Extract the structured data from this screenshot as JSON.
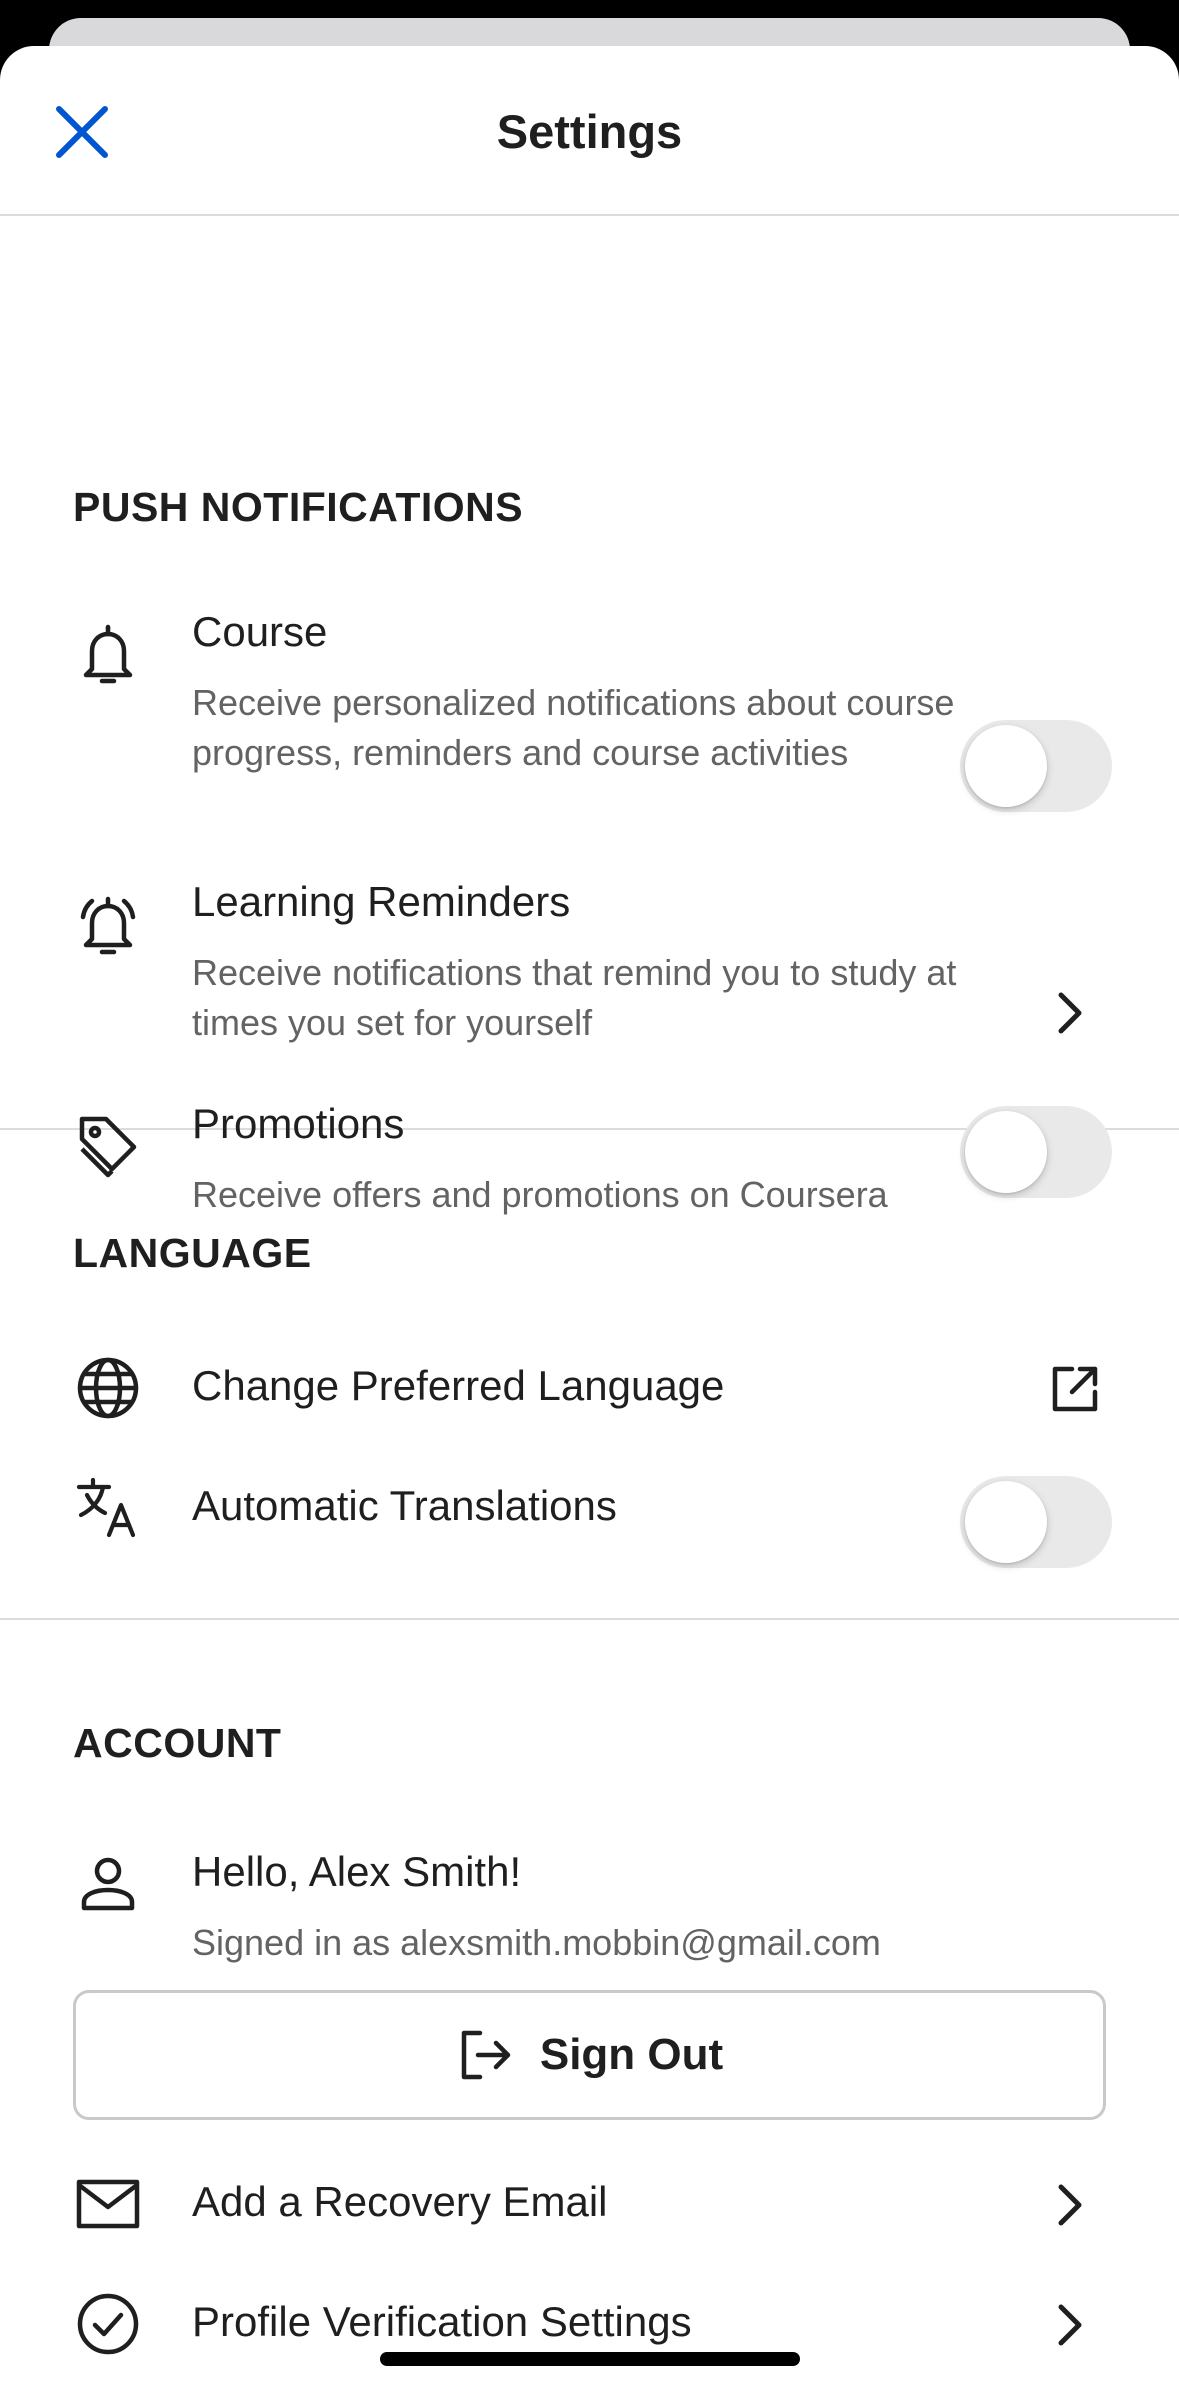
{
  "header": {
    "title": "Settings"
  },
  "push_notifications": {
    "title": "PUSH NOTIFICATIONS",
    "items": [
      {
        "label": "Course",
        "description": "Receive personalized notifications about course progress, reminders and course activities",
        "icon": "bell-icon",
        "control": "toggle",
        "enabled": false
      },
      {
        "label": "Learning Reminders",
        "description": "Receive notifications that remind you to study at times you set for yourself",
        "icon": "alarm-bell-icon",
        "control": "chevron"
      },
      {
        "label": "Promotions",
        "description": "Receive offers and promotions on Coursera",
        "icon": "tag-icon",
        "control": "toggle",
        "enabled": false
      }
    ]
  },
  "language": {
    "title": "LANGUAGE",
    "items": [
      {
        "label": "Change Preferred Language",
        "icon": "globe-icon",
        "control": "external-link"
      },
      {
        "label": "Automatic Translations",
        "icon": "translate-icon",
        "control": "toggle",
        "enabled": false
      }
    ]
  },
  "account": {
    "title": "ACCOUNT",
    "greeting": "Hello, Alex Smith!",
    "signed_in": "Signed in as alexsmith.mobbin@gmail.com",
    "sign_out_label": "Sign Out",
    "items": [
      {
        "label": "Add a Recovery Email",
        "icon": "mail-icon",
        "control": "chevron"
      },
      {
        "label": "Profile Verification Settings",
        "icon": "check-circle-icon",
        "control": "chevron"
      }
    ]
  },
  "colors": {
    "accent": "#0056d2",
    "toggle_off": "#e9e9ea",
    "text_primary": "#1f1f1f",
    "text_secondary": "#636363"
  }
}
